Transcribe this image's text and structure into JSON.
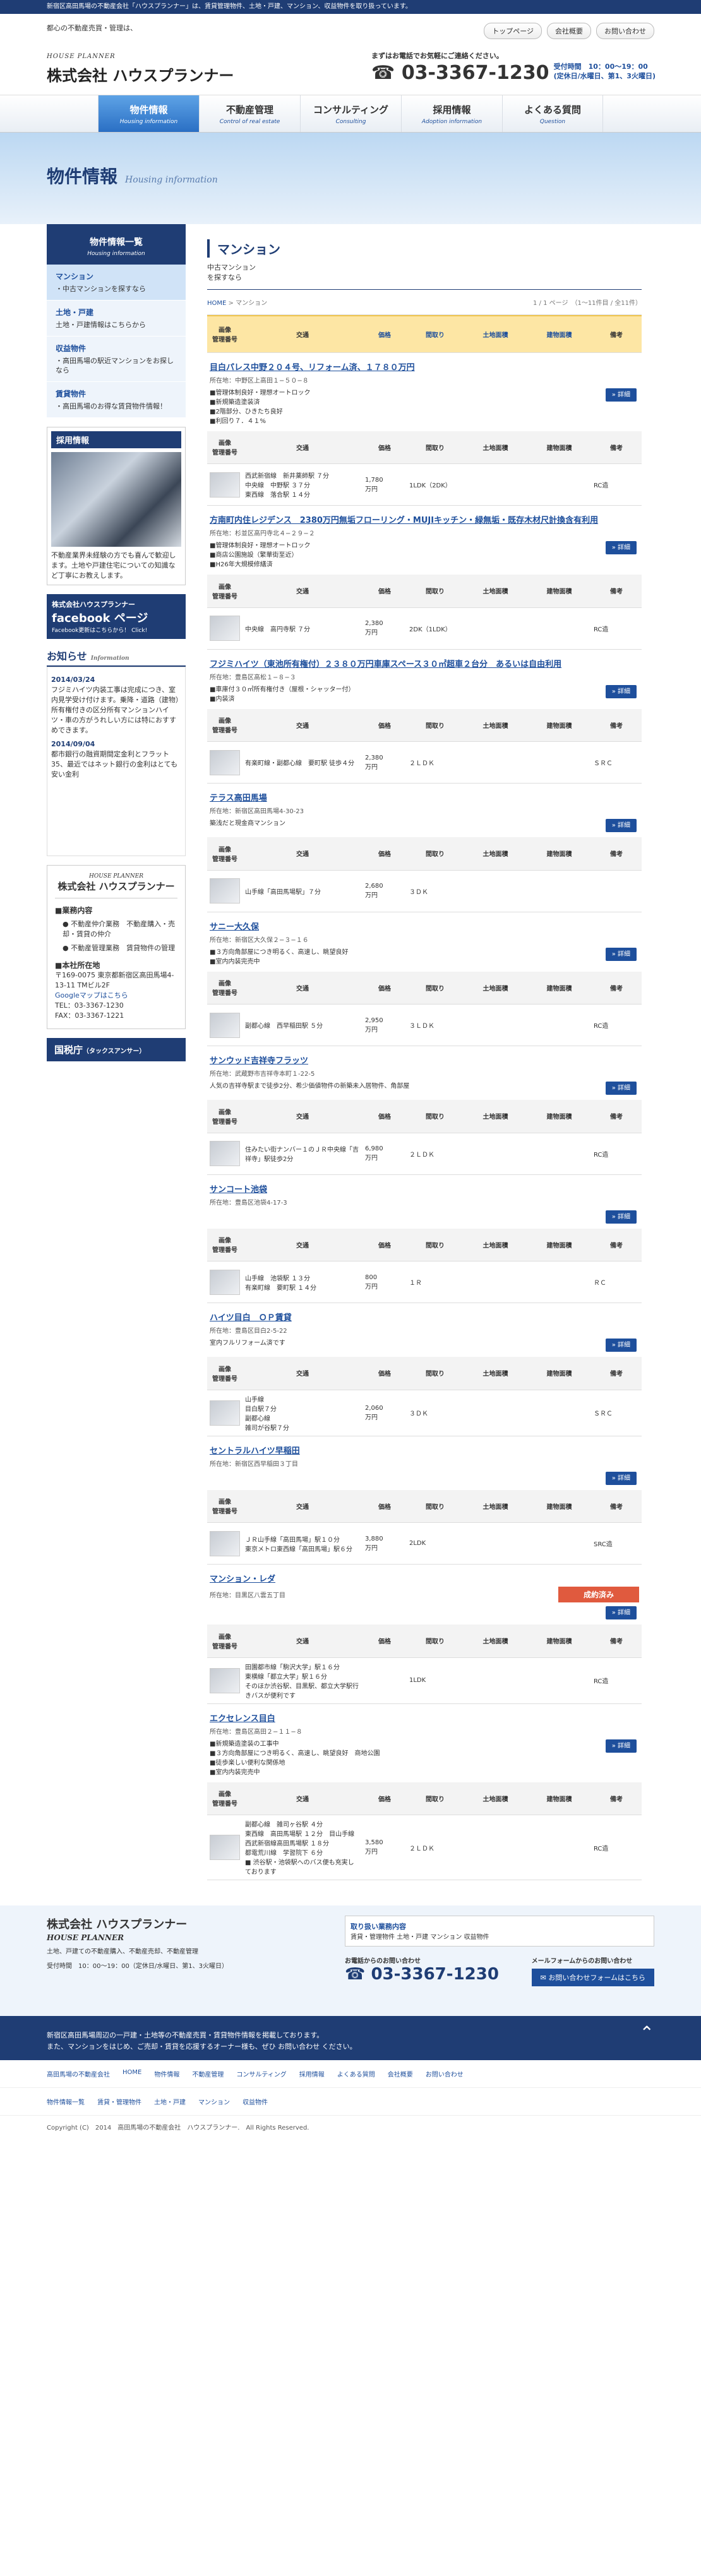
{
  "topbar": "新宿区高田馬場の不動産会社「ハウスプランナー」は、賃貸管理物件、土地・戸建、マンション、収益物件を取り扱っています。",
  "header": {
    "tagline": "都心の不動産売買・管理は、",
    "logo_sub": "HOUSE PLANNER",
    "logo": "株式会社 ハウスプランナー",
    "links": [
      "トップページ",
      "会社概要",
      "お問い合わせ"
    ],
    "tel_note": "まずはお電話でお気軽にご連絡ください。",
    "tel": "☎ 03-3367-1230",
    "hours": "受付時間　10：00〜19：00",
    "holiday": "(定休日/水曜日、第1、3火曜日)"
  },
  "gnav": [
    {
      "label": "物件情報",
      "en": "Housing information"
    },
    {
      "label": "不動産管理",
      "en": "Control of real estate"
    },
    {
      "label": "コンサルティング",
      "en": "Consulting"
    },
    {
      "label": "採用情報",
      "en": "Adoption information"
    },
    {
      "label": "よくある質問",
      "en": "Question"
    }
  ],
  "hero": {
    "title": "物件情報",
    "en": "Housing information"
  },
  "side": {
    "head": "物件情報一覧",
    "head_en": "Housing information",
    "items": [
      {
        "t": "マンション",
        "d": "・中古マンションを探すなら"
      },
      {
        "t": "土地・戸建",
        "d": "土地・戸建情報はこちらから"
      },
      {
        "t": "収益物件",
        "d": "・高田馬場の駅近マンションをお探しなら"
      },
      {
        "t": "賃貸物件",
        "d": "・高田馬場のお得な賃貸物件情報！"
      }
    ],
    "recruit_h": "採用情報",
    "recruit_p": "不動産業界未経験の方でも喜んで歓迎します。土地や戸建住宅についての知識など丁寧にお教えします。",
    "fb1": "株式会社ハウスプランナー",
    "fb2": "facebook ページ",
    "fb3": "Facebook更新はこちらから！ Click!",
    "news_h": "お知らせ",
    "news_en": "Information",
    "news": [
      {
        "d": "2014/03/24",
        "t": "フジミハイツ内装工事は完成につき、室内見学受け付けます。乗降・道路（建物）所有権付きの区分所有マンションハイツ・車の方がうれしい方には特におすすめできます。"
      },
      {
        "d": "2014/09/04",
        "t": "都市銀行の融資期間定金利とフラット35、最近ではネット銀行の金利はとても安い金利"
      }
    ],
    "c_en": "HOUSE PLANNER",
    "c_nm": "株式会社 ハウスプランナー",
    "biz_h": "■業務内容",
    "biz": [
      "● 不動産仲介業務　不動産購入・売却・賃貸の仲介",
      "● 不動産管理業務　賃貸物件の管理"
    ],
    "addr_h": "■本社所在地",
    "addr": "〒169-0075 東京都新宿区高田馬場4-13-11 TMビル2F",
    "map": "Googleマップはこちら",
    "tel": "TEL：03-3367-1230",
    "fax": "FAX：03-3367-1221",
    "tax": "国税庁",
    "tax_s": "（タックスアンサー）"
  },
  "main": {
    "title": "マンション",
    "lead1": "中古マンション",
    "lead2": "を探すなら",
    "crumb_home": "HOME",
    "crumb_cur": "マンション",
    "page": "1 / 1 ページ　（1〜11件目 / 全11件）",
    "head": [
      "画像\n管理番号",
      "交通",
      "価格",
      "間取り",
      "土地面積",
      "建物面積",
      "備考"
    ],
    "props": [
      {
        "title": "目白パレス中野２０４号、リフォーム済、１７８０万円",
        "addr": "所在地：中野区上高田１−５０−８",
        "feat": "■管理体制良好・理想オートロック\n■新規築造塗装済\n■2階部分、ひきたち良好\n■利回り７．４１%",
        "tr": "西武新宿線　新井薬師駅 ７分\n中央線　中野駅 ３７分\n東西線　落合駅 １４分",
        "price": "1,780\n万円",
        "lay": "1LDK（2DK）",
        "note": "RC造"
      },
      {
        "title": "方南町内住レジデンス　2380万円無垢フローリング・MUJIキッチン・緑無垢・既存木材尺計換含有利用",
        "addr": "所在地：杉並区高円寺北４−２９−２",
        "feat": "■管理体制良好・理想オートロック\n■商店公園施設（繁華街至近）\n■H26年大規模修繕済",
        "tr": "中央線　高円寺駅 ７分",
        "price": "2,380\n万円",
        "lay": "2DK（1LDK）",
        "note": "RC造"
      },
      {
        "title": "フジミハイツ（東池所有権付）２３８０万円車庫スペース３０㎡超車２台分　あるいは自由利用",
        "addr": "所在地：豊島区高松１−８−３",
        "feat": "■車庫付３０㎡所有権付き（屋根・シャッター付）\n■内装済",
        "tr": "有楽町線・副都心線　要町駅 徒歩４分",
        "price": "2,380\n万円",
        "lay": "２ＬＤＫ",
        "note": "ＳＲＣ"
      },
      {
        "title": "テラス高田馬場",
        "addr": "所在地：新宿区高田馬場4-30-23",
        "feat": "築浅だと現金商マンション",
        "tr": "山手線「高田馬場駅」７分",
        "price": "2,680\n万円",
        "lay": "３ＤＫ",
        "note": ""
      },
      {
        "title": "サニー大久保",
        "addr": "所在地：新宿区大久保２−３−１６",
        "feat": "■３方向角部屋につき明るく、高速し、眺望良好\n■室内内装完売中",
        "tr": "副都心線　西早稲田駅 ５分",
        "price": "2,950\n万円",
        "lay": "３ＬＤＫ",
        "note": "RC造"
      },
      {
        "title": "サンウッド吉祥寺フラッツ",
        "addr": "所在地：武蔵野市吉祥寺本町１-22-5",
        "feat": "人気の吉祥寺駅まで徒歩2分、希少価値物件の新築未入居物件、角部屋",
        "tr": "住みたい街ナンバー１のＪＲ中央線「吉祥寺」駅徒歩2分",
        "price": "6,980\n万円",
        "lay": "２ＬＤＫ",
        "note": "RC造"
      },
      {
        "title": "サンコート池袋",
        "addr": "所在地：豊島区池袋4-17-3",
        "feat": "",
        "tr": "山手線　池袋駅 １３分\n有楽町線　要町駅 １４分",
        "price": "800\n万円",
        "lay": "１Ｒ",
        "note": "ＲＣ"
      },
      {
        "title": "ハイツ目白　ＯＰ賃貸",
        "addr": "所在地：豊島区目白2-5-22",
        "feat": "室内フルリフォーム済です",
        "tr": "山手線\n目白駅７分\n副都心線\n雑司が谷駅７分",
        "price": "2,060\n万円",
        "lay": "３ＤＫ",
        "note": "ＳＲＣ"
      },
      {
        "title": "セントラルハイツ早稲田",
        "addr": "所在地：新宿区西早稲田３丁目",
        "feat": "",
        "tr": "ＪＲ山手線「高田馬場」駅１０分\n東京メトロ東西線「高田馬場」駅６分",
        "price": "3,880\n万円",
        "lay": "2LDK",
        "note": "SRC造"
      },
      {
        "title": "マンション・レダ",
        "addr": "所在地：目黒区八雲五丁目",
        "sold": "成約済み",
        "feat": "",
        "tr": "田園都市線「駒沢大学」駅１６分\n東横線「都立大学」駅１６分\nそのほか渋谷駅、目黒駅、都立大学駅行きバスが便利です",
        "price": "",
        "lay": "1LDK",
        "note": "RC造"
      },
      {
        "title": "エクセレンス目白",
        "addr": "所在地：豊島区高田２−１１−８",
        "feat": "■新規築造塗装の工事中\n■３方向角部屋につき明るく、高速し、眺望良好　商地公園\n■徒歩楽しい便利な関係地\n■室内内装完売中",
        "tr": "副都心線　雑司ヶ谷駅 ４分\n東西線　高田馬場駅 １２分　目山手線　西武新宿線高田馬場駅 １８分\n都電荒川線　学習院下 ６分\n■ 渋谷駅・池袋駅へのバス便も充実しております",
        "price": "3,580\n万円",
        "lay": "２ＬＤＫ",
        "note": "RC造"
      }
    ]
  },
  "detail_label": "» 詳細",
  "footer": {
    "nm": "株式会社 ハウスプランナー",
    "en": "HOUSE PLANNER",
    "biz": "土地、戸建ての不動産購入、不動産売却、不動産管理",
    "hours": "受付時間　10：00〜19：00（定休日/水曜日、第1、3火曜日）",
    "box_h": "取り扱い業務内容",
    "box_t": "賃貸・管理物件 土地・戸建 マンション 収益物件",
    "tel_label": "お電話からのお問い合わせ",
    "tel": "☎ 03-3367-1230",
    "mail_label": "メールフォームからのお問い合わせ",
    "mail_btn": "✉ お問い合わせフォームはこちら",
    "dark1": "新宿区高田馬場周辺の一戸建・土地等の不動産売買・賃貸物件情報を掲載しております。",
    "dark2": "また、マンションをはじめ、ご売却・賃貸を応援するオーナー様も、ぜひ お問い合わせ ください。",
    "links": [
      "高田馬場の不動産会社",
      "HOME",
      "物件情報",
      "不動産管理",
      "コンサルティング",
      "採用情報",
      "よくある質問",
      "会社概要",
      "お問い合わせ"
    ],
    "links2": [
      "物件情報一覧",
      "賃貸・管理物件",
      "土地・戸建",
      "マンション",
      "収益物件"
    ],
    "copy": "Copyright (C)　2014　高田馬場の不動産会社　ハウスプランナー.　All Rights Reserved."
  }
}
